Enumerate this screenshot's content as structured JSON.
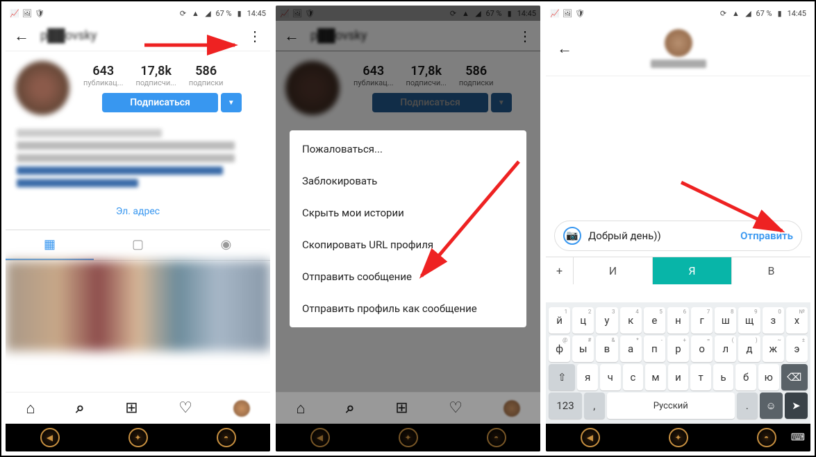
{
  "status": {
    "battery": "67 %",
    "time": "14:45"
  },
  "profile": {
    "username_display": "p██ovsky",
    "stats": {
      "posts": {
        "count": "643",
        "label": "публикац..."
      },
      "followers": {
        "count": "17,8k",
        "label": "подписчи..."
      },
      "following": {
        "count": "586",
        "label": "подписки"
      }
    },
    "follow_label": "Подписаться",
    "email_label": "Эл. адрес"
  },
  "menu": {
    "items": [
      "Пожаловаться...",
      "Заблокировать",
      "Скрыть мои истории",
      "Скопировать URL профиля",
      "Отправить сообщение",
      "Отправить профиль как сообщение"
    ]
  },
  "chat": {
    "input_text": "Добрый день))",
    "send_label": "Отправить"
  },
  "keyboard": {
    "suggestions": [
      "+",
      "И",
      "Я",
      "В"
    ],
    "row1": [
      {
        "k": "й",
        "s": "1"
      },
      {
        "k": "ц",
        "s": "2"
      },
      {
        "k": "у",
        "s": "3"
      },
      {
        "k": "к",
        "s": "4"
      },
      {
        "k": "е",
        "s": "5"
      },
      {
        "k": "н",
        "s": "6"
      },
      {
        "k": "г",
        "s": "7"
      },
      {
        "k": "ш",
        "s": "8"
      },
      {
        "k": "щ",
        "s": "9"
      },
      {
        "k": "з",
        "s": "0"
      },
      {
        "k": "х",
        "s": "№"
      }
    ],
    "row2": [
      {
        "k": "ф",
        "s": "@"
      },
      {
        "k": "ы",
        "s": "#"
      },
      {
        "k": "в",
        "s": "&"
      },
      {
        "k": "а",
        "s": "*"
      },
      {
        "k": "п",
        "s": "-"
      },
      {
        "k": "р",
        "s": "+"
      },
      {
        "k": "о",
        "s": "="
      },
      {
        "k": "л",
        "s": "("
      },
      {
        "k": "д",
        "s": ")"
      },
      {
        "k": "ж",
        "s": "~"
      },
      {
        "k": "э",
        "s": "±"
      }
    ],
    "row3": [
      "я",
      "ч",
      "с",
      "м",
      "и",
      "т",
      "ь",
      "б",
      "ю"
    ],
    "numeric_label": "123",
    "space_label": "Русский"
  }
}
